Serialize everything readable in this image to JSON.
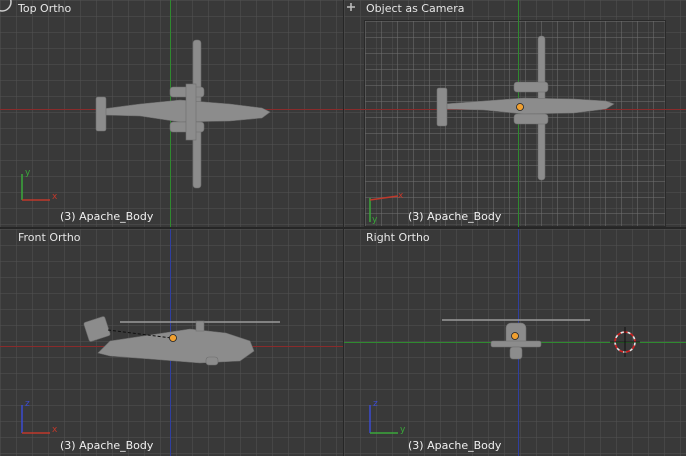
{
  "viewports": {
    "top_left": {
      "title": "Top Ortho",
      "object_label": "(3) Apache_Body",
      "axes": [
        "x",
        "y"
      ]
    },
    "top_right": {
      "title": "Object as Camera",
      "object_label": "(3) Apache_Body",
      "axes": [
        "x",
        "y"
      ]
    },
    "bottom_left": {
      "title": "Front Ortho",
      "object_label": "(3) Apache_Body",
      "axes": [
        "x",
        "z"
      ]
    },
    "bottom_right": {
      "title": "Right Ortho",
      "object_label": "(3) Apache_Body",
      "axes": [
        "y",
        "z"
      ]
    }
  },
  "colors": {
    "background": "#393939",
    "x_axis": "#c0392b",
    "y_axis": "#3aa83a",
    "z_axis": "#3b4bd0",
    "model": "#8a8a8a",
    "origin": "#f0a030"
  },
  "icons": [
    "corner-plus-icon",
    "3d-cursor-icon",
    "helicopter-model"
  ]
}
